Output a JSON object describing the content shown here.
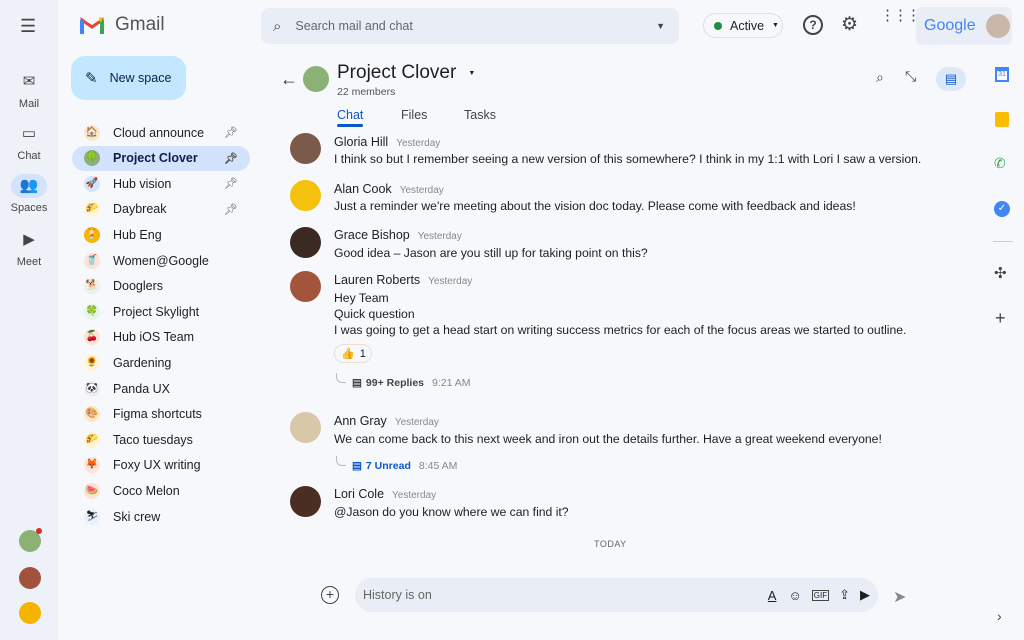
{
  "app": {
    "name": "Gmail",
    "search_placeholder": "Search mail and chat",
    "status": "Active",
    "google": "Google"
  },
  "rail": [
    {
      "label": "Mail",
      "icon": "mail-icon"
    },
    {
      "label": "Chat",
      "icon": "chat-icon"
    },
    {
      "label": "Spaces",
      "icon": "spaces-icon"
    },
    {
      "label": "Meet",
      "icon": "meet-icon"
    }
  ],
  "new_space": "New space",
  "spaces": [
    {
      "label": "Cloud announce",
      "pinned": true,
      "emoji": "🏠"
    },
    {
      "label": "Project Clover",
      "pinned": true,
      "emoji": "🍀",
      "active": true
    },
    {
      "label": "Hub vision",
      "pinned": true,
      "emoji": "🚀"
    },
    {
      "label": "Daybreak",
      "pinned": true,
      "emoji": "🌮"
    },
    {
      "label": "Hub Eng",
      "emoji": "🍹"
    },
    {
      "label": "Women@Google",
      "emoji": "🥤"
    },
    {
      "label": "Dooglers",
      "emoji": "🐕"
    },
    {
      "label": "Project Skylight",
      "emoji": "🍀"
    },
    {
      "label": "Hub iOS Team",
      "emoji": "🍒"
    },
    {
      "label": "Gardening",
      "emoji": "🌻"
    },
    {
      "label": "Panda UX",
      "emoji": "🐼"
    },
    {
      "label": "Figma shortcuts",
      "emoji": "🎨"
    },
    {
      "label": "Taco tuesdays",
      "emoji": "🌮"
    },
    {
      "label": "Foxy UX writing",
      "emoji": "🦊"
    },
    {
      "label": "Coco Melon",
      "emoji": "🍉"
    },
    {
      "label": "Ski crew",
      "emoji": "⛷"
    }
  ],
  "room": {
    "title": "Project Clover",
    "members": "22 members",
    "tabs": [
      "Chat",
      "Files",
      "Tasks"
    ]
  },
  "messages": [
    {
      "name": "Gloria Hill",
      "time": "Yesterday",
      "lines": [
        "I think so but I remember seeing a new version of this somewhere? I think in my 1:1 with Lori I saw a version."
      ]
    },
    {
      "name": "Alan Cook",
      "time": "Yesterday",
      "lines": [
        "Just a reminder we're meeting about the vision doc today. Please come with feedback and ideas!"
      ]
    },
    {
      "name": "Grace Bishop",
      "time": "Yesterday",
      "lines": [
        "Good idea – Jason are you still up for taking point on this?"
      ]
    },
    {
      "name": "Lauren Roberts",
      "time": "Yesterday",
      "lines": [
        "Hey Team",
        "Quick question",
        "I was going to get a head start on writing success metrics for each of the focus areas we started to outline."
      ],
      "reaction": {
        "emoji": "👍",
        "count": "1"
      },
      "thread": {
        "label": "99+ Replies",
        "time": "9:21 AM"
      }
    },
    {
      "name": "Ann Gray",
      "time": "Yesterday",
      "lines": [
        "We can come back to this next week and iron out the details further. Have a great weekend everyone!"
      ],
      "thread": {
        "label": "7 Unread",
        "time": "8:45 AM"
      }
    },
    {
      "name": "Lori Cole",
      "time": "Yesterday",
      "lines": [
        "@Jason do you know where we can find it?"
      ]
    }
  ],
  "divider": "TODAY",
  "composer": {
    "placeholder": "History is on"
  },
  "colors": {
    "accent": "#0b57d0",
    "active_bg": "#d3e3fd",
    "status_green": "#1e8e3e"
  }
}
